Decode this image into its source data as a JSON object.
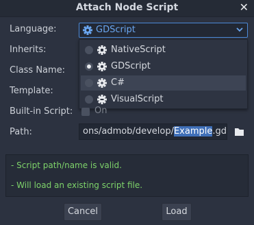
{
  "dialog": {
    "title": "Attach Node Script",
    "close_icon": "close-icon"
  },
  "form": {
    "language_label": "Language:",
    "inherits_label": "Inherits:",
    "class_name_label": "Class Name:",
    "template_label": "Template:",
    "builtin_label": "Built-in Script:",
    "builtin_value": "On",
    "path_label": "Path:"
  },
  "language": {
    "selected": "GDScript",
    "options": [
      {
        "label": "NativeScript",
        "icon": "nativescript-icon",
        "checked": false,
        "highlighted": false
      },
      {
        "label": "GDScript",
        "icon": "gdscript-gear-icon",
        "checked": true,
        "highlighted": false
      },
      {
        "label": "C#",
        "icon": "csharp-icon",
        "checked": false,
        "highlighted": true
      },
      {
        "label": "VisualScript",
        "icon": "visualscript-icon",
        "checked": false,
        "highlighted": false
      }
    ]
  },
  "path": {
    "prefix": "ons/admob/develop/",
    "selected": "Example",
    "suffix": ".gd"
  },
  "status": {
    "line1": "- Script path/name is valid.",
    "line2": "- Will load an existing script file."
  },
  "buttons": {
    "cancel": "Cancel",
    "load": "Load"
  },
  "colors": {
    "background": "#2c3240",
    "accent": "#4c8ad8",
    "status_ok": "#7ed36a",
    "selection": "#3f6fb8"
  }
}
